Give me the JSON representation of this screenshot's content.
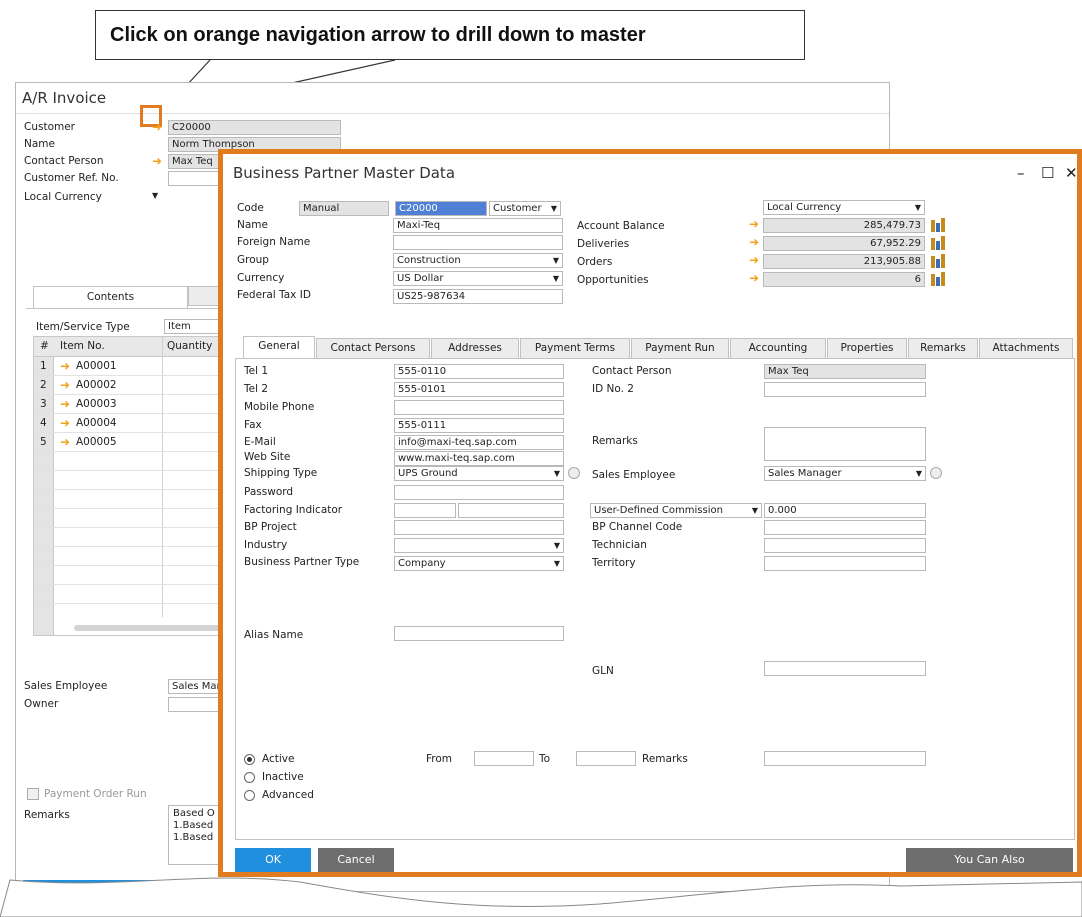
{
  "callout": "Click on orange navigation arrow to drill down to master",
  "invoice": {
    "title": "A/R Invoice",
    "fields": [
      {
        "label": "Customer",
        "value": "C20000"
      },
      {
        "label": "Name",
        "value": "Norm Thompson"
      },
      {
        "label": "Contact Person",
        "value": "Max Teq"
      },
      {
        "label": "Customer Ref. No.",
        "value": ""
      }
    ],
    "currency": "Local Currency",
    "tabs": [
      "Contents"
    ],
    "item_type_label": "Item/Service Type",
    "item_type_value": "Item",
    "grid": {
      "headers": [
        "#",
        "Item No.",
        "Quantity"
      ],
      "rows": [
        {
          "num": "1",
          "item": "A00001"
        },
        {
          "num": "2",
          "item": "A00002"
        },
        {
          "num": "3",
          "item": "A00003"
        },
        {
          "num": "4",
          "item": "A00004"
        },
        {
          "num": "5",
          "item": "A00005"
        }
      ]
    },
    "sales_employee_label": "Sales Employee",
    "sales_employee_value": "Sales Mar",
    "owner_label": "Owner",
    "payment_order_run": "Payment Order Run",
    "remarks_label": "Remarks",
    "remarks_lines": [
      "Based O",
      "1.Based",
      "1.Based"
    ]
  },
  "bp": {
    "title": "Business Partner Master Data",
    "window_controls": {
      "minimize": "–",
      "maximize": "☐",
      "close": "✕"
    },
    "code_label": "Code",
    "code_series": "Manual",
    "code_value": "C20000",
    "type_value": "Customer",
    "name_label": "Name",
    "name_value": "Maxi-Teq",
    "foreign_label": "Foreign Name",
    "group_label": "Group",
    "group_value": "Construction",
    "currency_label": "Currency",
    "currency_value": "US Dollar",
    "taxid_label": "Federal Tax ID",
    "taxid_value": "US25-987634",
    "right_currency": "Local Currency",
    "balances": [
      {
        "label": "Account Balance",
        "value": "285,479.73"
      },
      {
        "label": "Deliveries",
        "value": "67,952.29"
      },
      {
        "label": "Orders",
        "value": "213,905.88"
      },
      {
        "label": "Opportunities",
        "value": "6"
      }
    ],
    "tabs": [
      "General",
      "Contact Persons",
      "Addresses",
      "Payment Terms",
      "Payment Run",
      "Accounting",
      "Properties",
      "Remarks",
      "Attachments"
    ],
    "general_left": [
      {
        "label": "Tel 1",
        "value": "555-0110"
      },
      {
        "label": "Tel 2",
        "value": "555-0101"
      },
      {
        "label": "Mobile Phone",
        "value": ""
      },
      {
        "label": "Fax",
        "value": "555-0111"
      },
      {
        "label": "E-Mail",
        "value": "info@maxi-teq.sap.com"
      },
      {
        "label": "Web Site",
        "value": "www.maxi-teq.sap.com"
      },
      {
        "label": "Shipping Type",
        "value": "UPS Ground"
      },
      {
        "label": "Password",
        "value": ""
      },
      {
        "label": "Factoring Indicator",
        "value": ""
      },
      {
        "label": "BP Project",
        "value": ""
      },
      {
        "label": "Industry",
        "value": ""
      },
      {
        "label": "Business Partner Type",
        "value": "Company"
      }
    ],
    "general_right": [
      {
        "label": "Contact Person",
        "value": "Max Teq"
      },
      {
        "label": "ID No. 2",
        "value": ""
      },
      {
        "label": "Remarks",
        "value": ""
      },
      {
        "label": "Sales Employee",
        "value": "Sales Manager"
      },
      {
        "label": "User-Defined Commission",
        "value": "0.000"
      },
      {
        "label": "BP Channel Code",
        "value": ""
      },
      {
        "label": "Technician",
        "value": ""
      },
      {
        "label": "Territory",
        "value": ""
      }
    ],
    "alias_label": "Alias Name",
    "gln_label": "GLN",
    "status": [
      "Active",
      "Inactive",
      "Advanced"
    ],
    "from_label": "From",
    "to_label": "To",
    "remarks2_label": "Remarks",
    "ok": "OK",
    "cancel": "Cancel",
    "you_can_also": "You Can Also"
  },
  "colors": {
    "accent_orange": "#e07c1f",
    "nav_arrow": "#f2a31b",
    "ok_blue": "#1f8fde",
    "cancel_gray": "#6e6e6e"
  }
}
